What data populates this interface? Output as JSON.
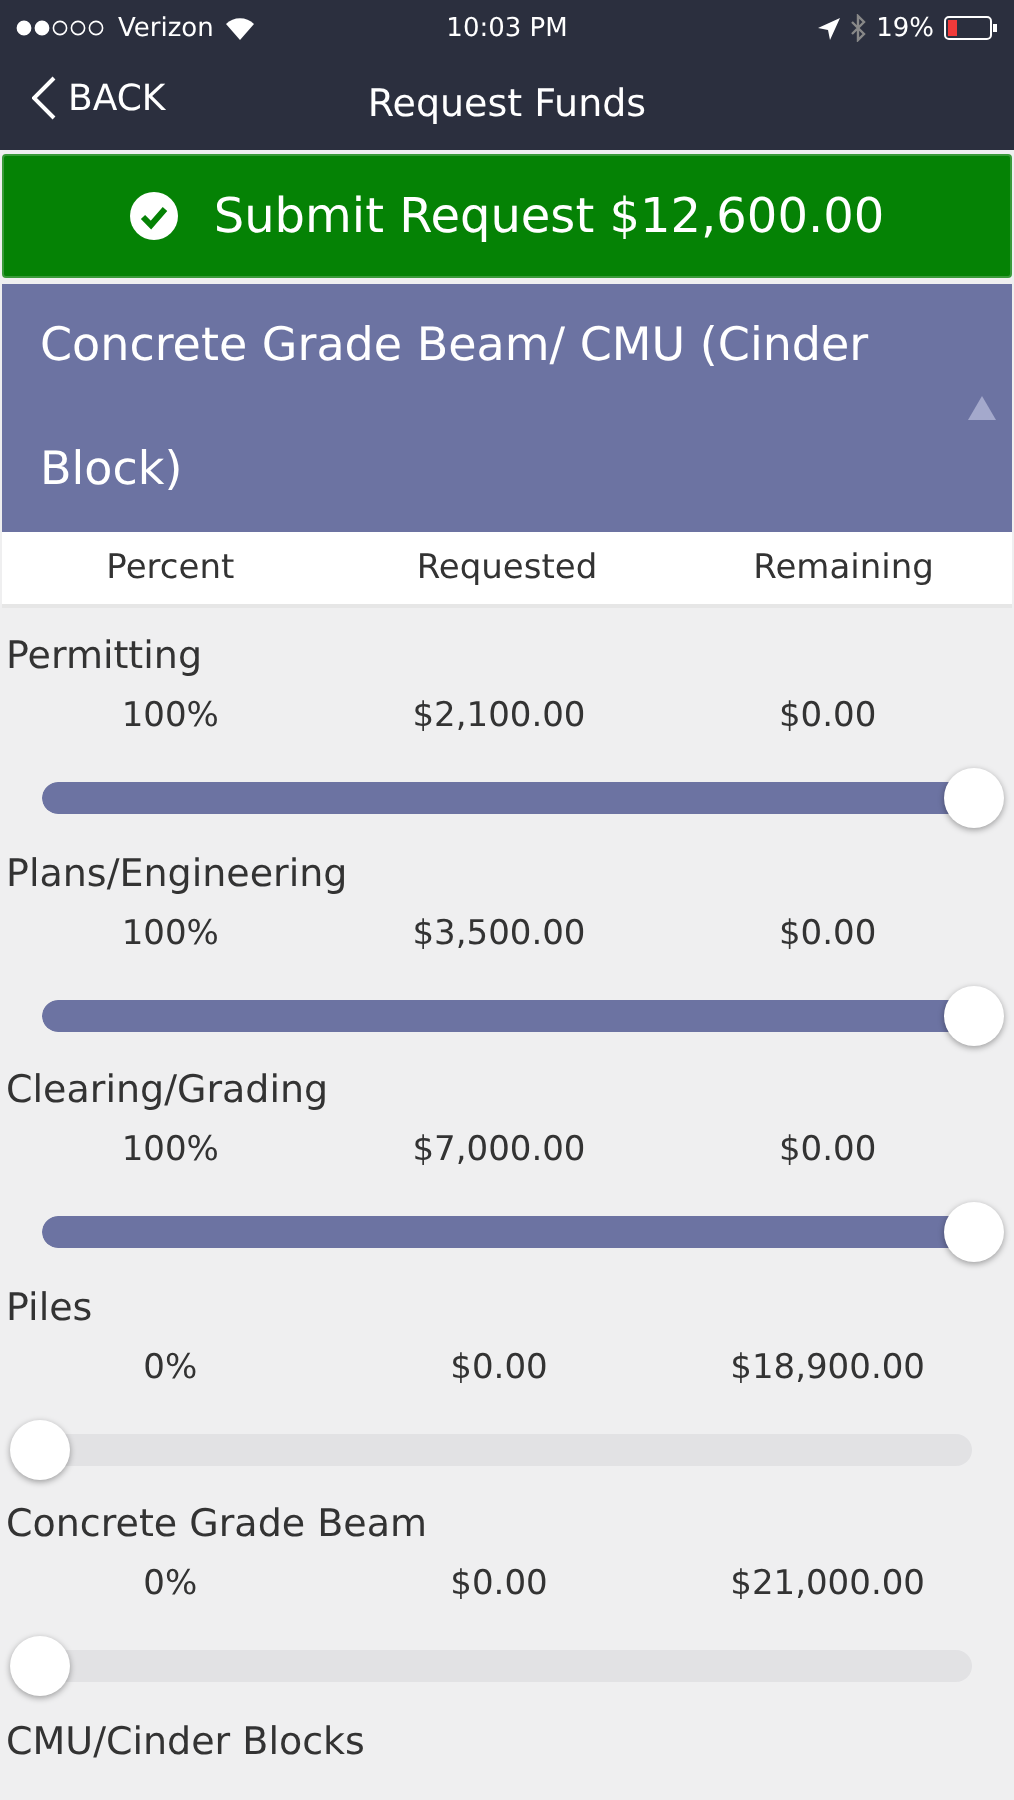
{
  "status_bar": {
    "carrier": "Verizon",
    "time": "10:03 PM",
    "battery": "19%"
  },
  "nav": {
    "back": "BACK",
    "title": "Request Funds"
  },
  "submit_button": {
    "label": "Submit Request $12,600.00"
  },
  "section": {
    "title": "Concrete Grade Beam/ CMU (Cinder Block)",
    "expanded": true
  },
  "columns": [
    "Percent",
    "Requested",
    "Remaining"
  ],
  "items": [
    {
      "name": "Permitting",
      "percent": "100%",
      "requested": "$2,100.00",
      "remaining": "$0.00",
      "level": 1
    },
    {
      "name": "Plans/Engineering",
      "percent": "100%",
      "requested": "$3,500.00",
      "remaining": "$0.00",
      "level": 1
    },
    {
      "name": "Clearing/Grading",
      "percent": "100%",
      "requested": "$7,000.00",
      "remaining": "$0.00",
      "level": 1
    },
    {
      "name": "Piles",
      "percent": "0%",
      "requested": "$0.00",
      "remaining": "$18,900.00",
      "level": 0
    },
    {
      "name": "Concrete Grade Beam",
      "percent": "0%",
      "requested": "$0.00",
      "remaining": "$21,000.00",
      "level": 0
    },
    {
      "name": "CMU/Cinder Blocks"
    }
  ]
}
